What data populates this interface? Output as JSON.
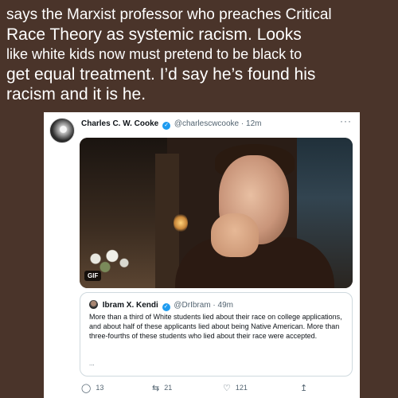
{
  "caption": {
    "line1": "says the Marxist professor who preaches Critical",
    "line2": "Race Theory as systemic racism.  Looks",
    "line3": "like white kids now must pretend to be black to",
    "line4": "get equal treatment.  I’d say he’s found his",
    "line5": "racism and it is he."
  },
  "tweet": {
    "author_name": "Charles C. W. Cooke",
    "handle": "@charlescwcooke",
    "separator": "·",
    "time": "12m",
    "more": "···",
    "media_badge": "GIF",
    "quote": {
      "author_name": "Ibram X. Kendi",
      "handle": "@DrIbram",
      "separator": "·",
      "time": "49m",
      "text": "More than a third of White students lied about their race on college applications, and about half of these applicants lied about being Native American. More than three-fourths of these students who lied about their race were accepted.",
      "ellipsis": "..."
    },
    "actions": {
      "replies": "13",
      "retweets": "21",
      "likes": "121"
    }
  },
  "icons": {
    "reply": "reply-icon",
    "retweet": "retweet-icon",
    "like": "like-icon",
    "share": "share-icon",
    "verified": "verified-icon",
    "verified_color": "#1d9bf0"
  }
}
